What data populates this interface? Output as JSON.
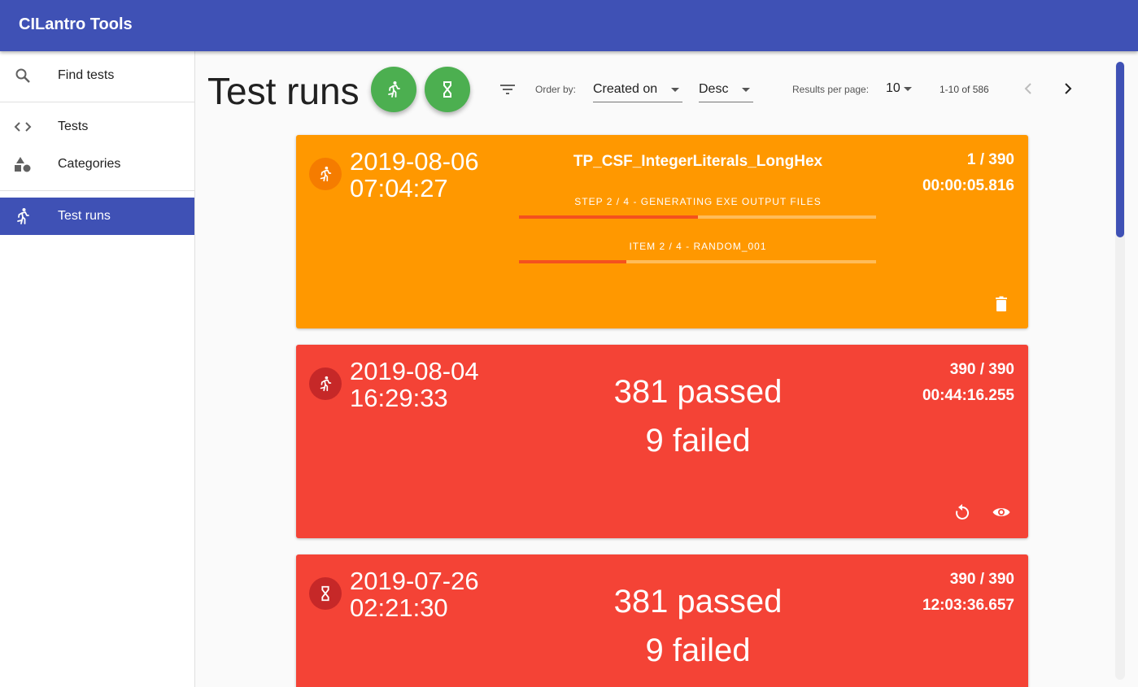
{
  "app": {
    "title": "CILantro Tools"
  },
  "sidebar": {
    "items": [
      {
        "label": "Find tests",
        "icon": "search-icon"
      },
      {
        "label": "Tests",
        "icon": "code-icon"
      },
      {
        "label": "Categories",
        "icon": "shapes-icon"
      },
      {
        "label": "Test runs",
        "icon": "run-icon",
        "active": true
      }
    ]
  },
  "toolbar": {
    "page_title": "Test runs",
    "order_by_label": "Order by:",
    "order_by_value": "Created on",
    "direction_value": "Desc",
    "results_per_page_label": "Results per page:",
    "results_per_page_value": "10",
    "range_text": "1-10 of 586"
  },
  "runs": [
    {
      "status": "running",
      "status_icon": "run-icon",
      "date": "2019-08-06",
      "time": "07:04:27",
      "count": "1 / 390",
      "duration": "00:00:05.816",
      "test_name": "TP_CSF_IntegerLiterals_LongHex",
      "step_label": "STEP 2 / 4 - GENERATING EXE OUTPUT FILES",
      "step_progress": 0.5,
      "item_label": "ITEM 2 / 4 - RANDOM_001",
      "item_progress": 0.3,
      "color": "#ff9800"
    },
    {
      "status": "finished",
      "status_icon": "run-icon",
      "date": "2019-08-04",
      "time": "16:29:33",
      "count": "390 / 390",
      "duration": "00:44:16.255",
      "passed": "381 passed",
      "failed": "9 failed",
      "color": "#f44336"
    },
    {
      "status": "finished",
      "status_icon": "hourglass-icon",
      "date": "2019-07-26",
      "time": "02:21:30",
      "count": "390 / 390",
      "duration": "12:03:36.657",
      "passed": "381 passed",
      "failed": "9 failed",
      "color": "#f44336"
    }
  ]
}
